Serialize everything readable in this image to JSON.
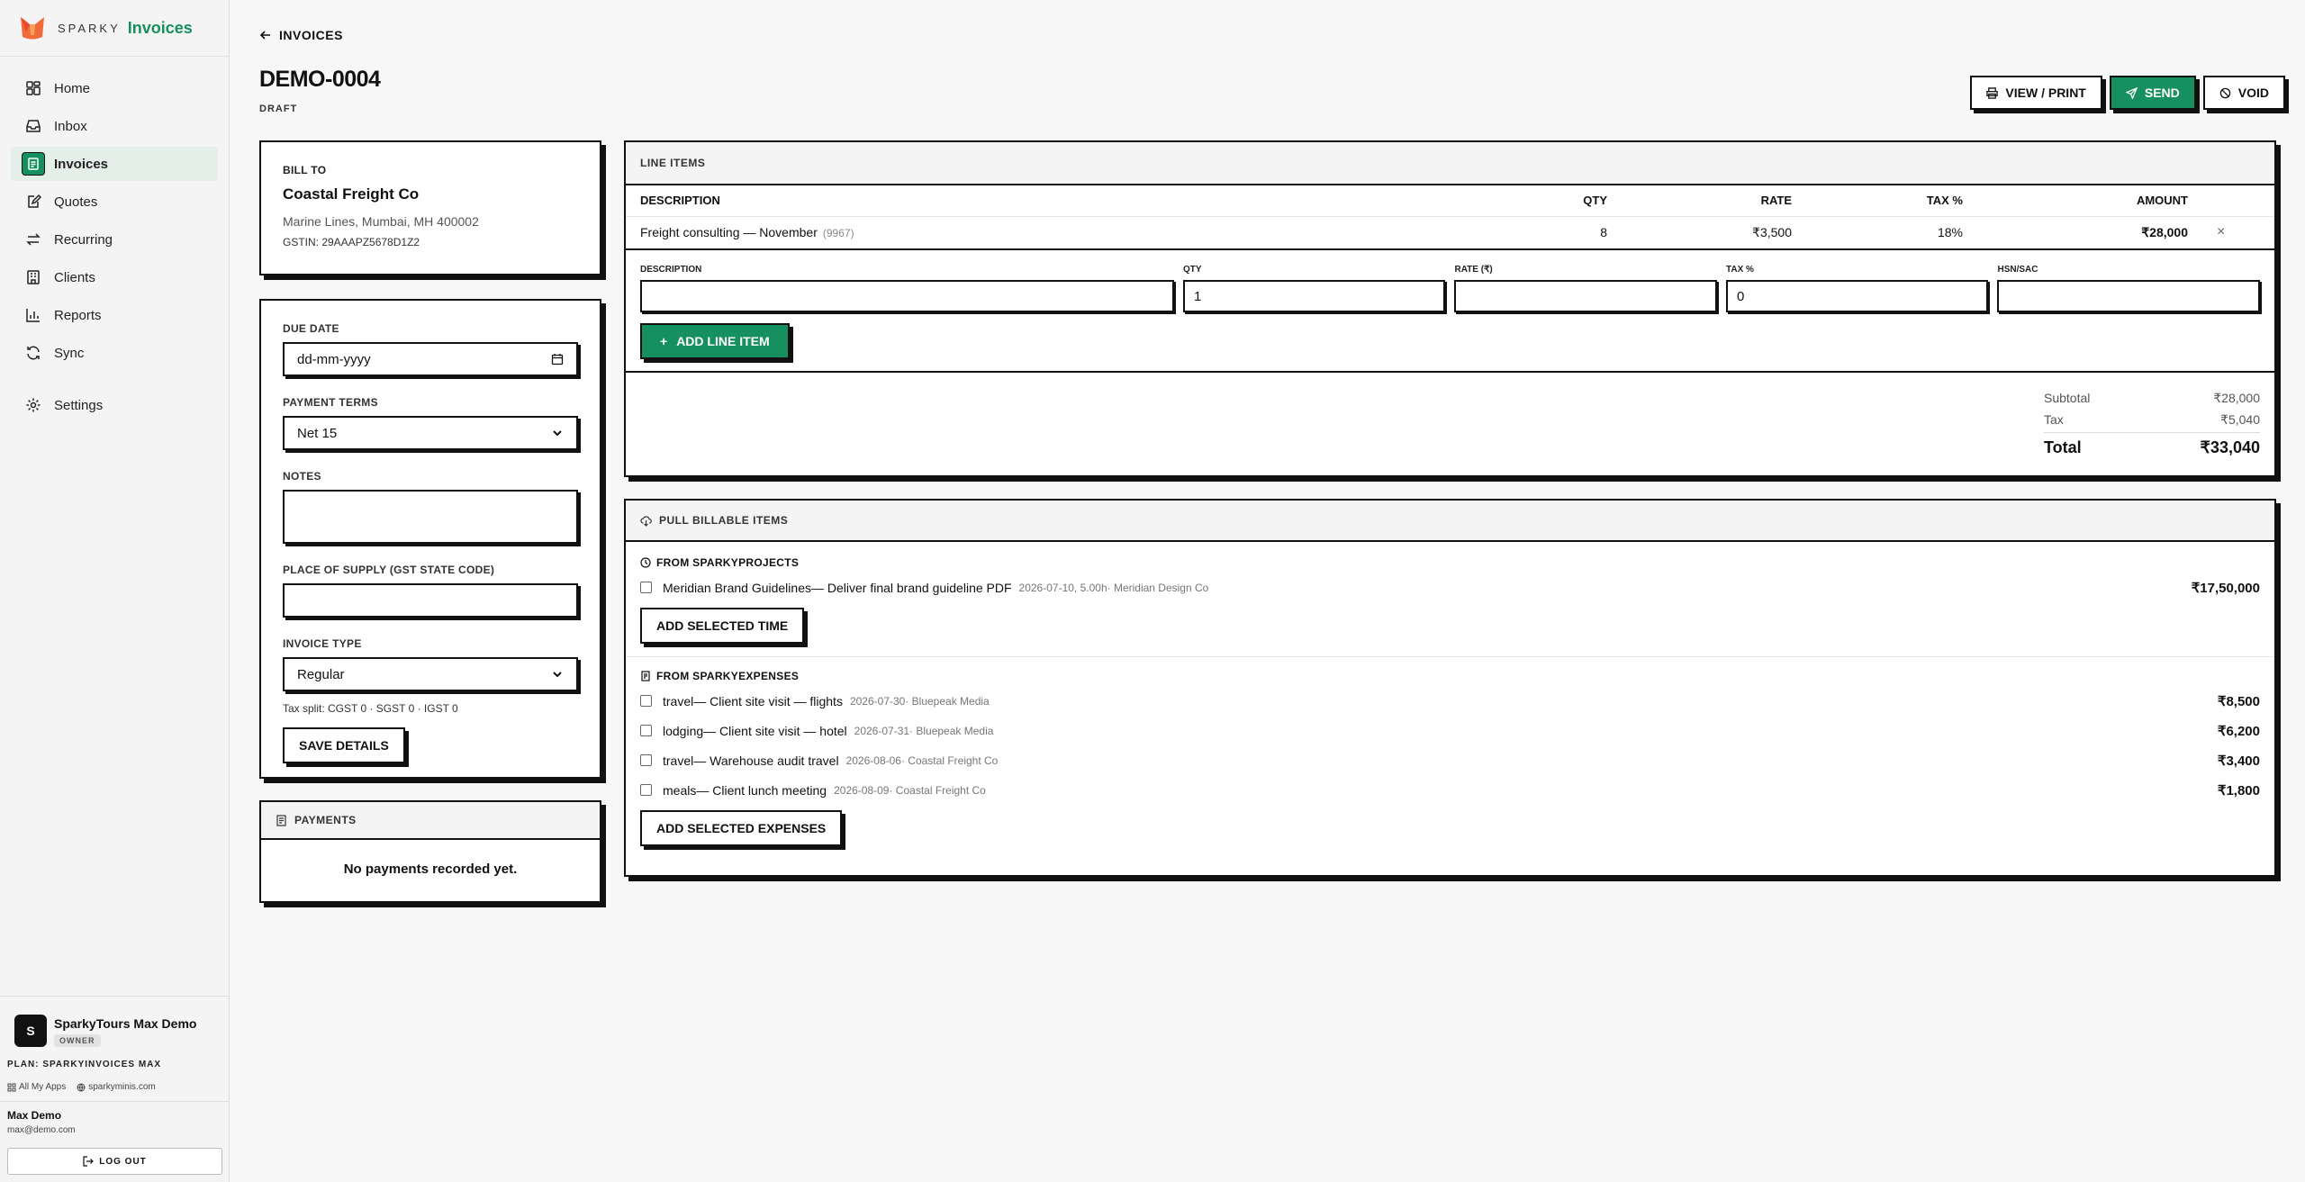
{
  "brand": {
    "sparky": "SPARKY",
    "product": "Invoices"
  },
  "nav": [
    {
      "label": "Home",
      "icon": "home-icon"
    },
    {
      "label": "Inbox",
      "icon": "inbox-icon"
    },
    {
      "label": "Invoices",
      "icon": "invoice-icon",
      "active": true
    },
    {
      "label": "Quotes",
      "icon": "quote-icon"
    },
    {
      "label": "Recurring",
      "icon": "recurring-icon"
    },
    {
      "label": "Clients",
      "icon": "clients-icon"
    },
    {
      "label": "Reports",
      "icon": "reports-icon"
    },
    {
      "label": "Sync",
      "icon": "sync-icon"
    },
    {
      "label": "Settings",
      "icon": "gear-icon"
    }
  ],
  "org": {
    "initial": "S",
    "name": "SparkyTours Max Demo",
    "role": "OWNER"
  },
  "plan": "PLAN: SPARKYINVOICES MAX",
  "links": {
    "apps": "All My Apps",
    "site": "sparkyminis.com"
  },
  "user": {
    "name": "Max Demo",
    "email": "max@demo.com"
  },
  "logout": "LOG OUT",
  "header": {
    "back": "INVOICES",
    "title": "DEMO-0004",
    "status": "DRAFT"
  },
  "actions": {
    "view_print": "VIEW / PRINT",
    "send": "SEND",
    "void": "VOID"
  },
  "billto": {
    "label": "BILL TO",
    "name": "Coastal Freight Co",
    "address": "Marine Lines, Mumbai, MH 400002",
    "gstin": "GSTIN: 29AAAPZ5678D1Z2"
  },
  "details": {
    "due_label": "DUE DATE",
    "due_placeholder": "dd-mm-yyyy",
    "terms_label": "PAYMENT TERMS",
    "terms_value": "Net 15",
    "notes_label": "NOTES",
    "notes_value": "",
    "supply_label": "PLACE OF SUPPLY (GST STATE CODE)",
    "supply_value": "",
    "type_label": "INVOICE TYPE",
    "type_value": "Regular",
    "tax_split": "Tax split: CGST 0 · SGST 0 · IGST 0",
    "save": "SAVE DETAILS"
  },
  "payments": {
    "title": "PAYMENTS",
    "empty": "No payments recorded yet."
  },
  "line_items": {
    "title": "LINE ITEMS",
    "columns": {
      "description": "DESCRIPTION",
      "qty": "QTY",
      "rate": "RATE",
      "tax": "TAX %",
      "amount": "AMOUNT"
    },
    "rows": [
      {
        "description": "Freight consulting — November",
        "hsn": "(9967)",
        "qty": "8",
        "rate": "₹3,500",
        "tax": "18%",
        "amount": "₹28,000",
        "remove": "×"
      }
    ],
    "add": {
      "description_label": "DESCRIPTION",
      "description_value": "",
      "qty_label": "QTY",
      "qty_value": "1",
      "rate_label": "RATE (₹)",
      "rate_value": "",
      "tax_label": "TAX %",
      "tax_value": "0",
      "hsn_label": "HSN/SAC",
      "hsn_value": "",
      "button": "ADD LINE ITEM",
      "button_prefix": "+"
    },
    "totals": {
      "subtotal_label": "Subtotal",
      "subtotal": "₹28,000",
      "tax_label": "Tax",
      "tax": "₹5,040",
      "total_label": "Total",
      "total": "₹33,040"
    }
  },
  "billable": {
    "title": "PULL BILLABLE ITEMS",
    "projects": {
      "title": "FROM SPARKYPROJECTS",
      "items": [
        {
          "label": "Meridian Brand Guidelines— Deliver final brand guideline PDF",
          "meta": "2026-07-10, 5.00h· Meridian Design Co",
          "amount": "₹17,50,000"
        }
      ],
      "button": "ADD SELECTED TIME"
    },
    "expenses": {
      "title": "FROM SPARKYEXPENSES",
      "items": [
        {
          "label": "travel— Client site visit — flights",
          "meta": "2026-07-30· Bluepeak Media",
          "amount": "₹8,500"
        },
        {
          "label": "lodging— Client site visit — hotel",
          "meta": "2026-07-31· Bluepeak Media",
          "amount": "₹6,200"
        },
        {
          "label": "travel— Warehouse audit travel",
          "meta": "2026-08-06· Coastal Freight Co",
          "amount": "₹3,400"
        },
        {
          "label": "meals— Client lunch meeting",
          "meta": "2026-08-09· Coastal Freight Co",
          "amount": "₹1,800"
        }
      ],
      "button": "ADD SELECTED EXPENSES"
    }
  },
  "colors": {
    "accent": "#17905f",
    "border": "#111111"
  }
}
